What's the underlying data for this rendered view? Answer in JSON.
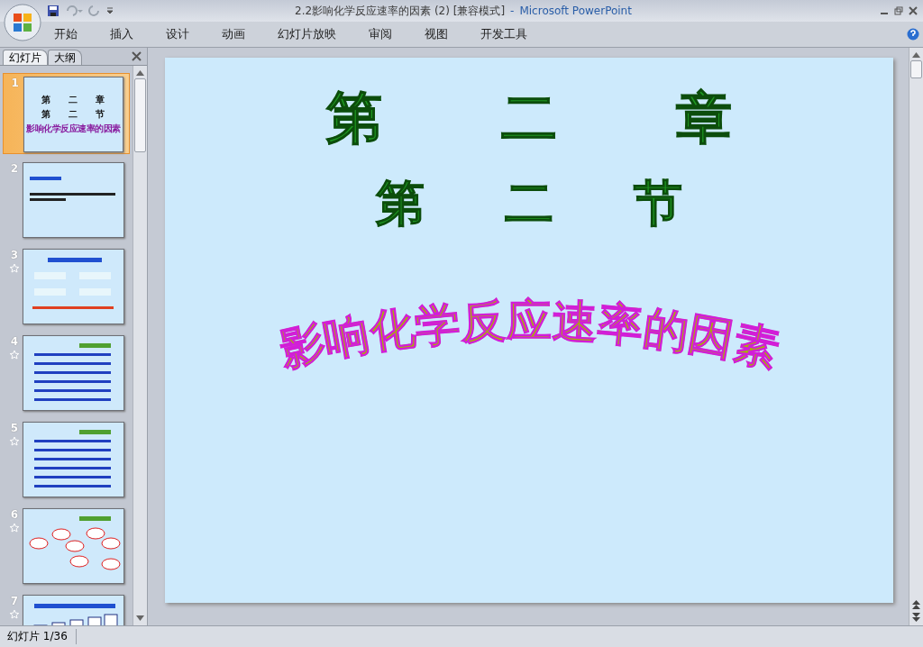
{
  "window": {
    "title": "2.2影响化学反应速率的因素 (2) [兼容模式]",
    "separator": "-",
    "app_name": "Microsoft PowerPoint"
  },
  "ribbon_tabs": [
    "开始",
    "插入",
    "设计",
    "动画",
    "幻灯片放映",
    "审阅",
    "视图",
    "开发工具"
  ],
  "pane_tabs": [
    {
      "label": "幻灯片",
      "selected": true
    },
    {
      "label": "大纲",
      "selected": false
    }
  ],
  "slides": [
    {
      "number": "1",
      "selected": true,
      "animated": false,
      "kind": "title",
      "heading": [
        "第",
        "二",
        "章"
      ],
      "subheading": [
        "第",
        "二",
        "节"
      ],
      "title": "影响化学反应速率的因素"
    },
    {
      "number": "2",
      "selected": false,
      "animated": false,
      "kind": "text"
    },
    {
      "number": "3",
      "selected": false,
      "animated": true,
      "kind": "flow"
    },
    {
      "number": "4",
      "selected": false,
      "animated": true,
      "kind": "list"
    },
    {
      "number": "5",
      "selected": false,
      "animated": true,
      "kind": "list"
    },
    {
      "number": "6",
      "selected": false,
      "animated": true,
      "kind": "diagram"
    },
    {
      "number": "7",
      "selected": false,
      "animated": true,
      "kind": "chart"
    }
  ],
  "current_slide": {
    "heading": [
      "第",
      "二",
      "章"
    ],
    "subheading": [
      "第",
      "二",
      "节"
    ],
    "title": "影响化学反应速率的因素"
  },
  "status_bar": {
    "slide_indicator": "幻灯片 1/36"
  }
}
